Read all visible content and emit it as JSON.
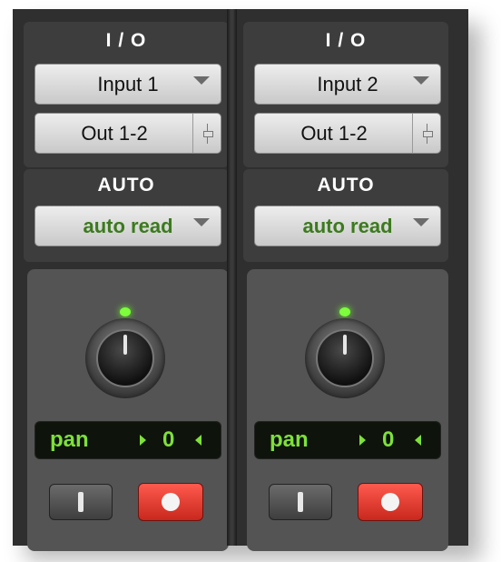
{
  "strips": [
    {
      "io_header": "I / O",
      "input_label": "Input 1",
      "output_label": "Out 1-2",
      "auto_header": "AUTO",
      "auto_mode": "auto read",
      "pan_label": "pan",
      "pan_value": "0"
    },
    {
      "io_header": "I / O",
      "input_label": "Input 2",
      "output_label": "Out 1-2",
      "auto_header": "AUTO",
      "auto_mode": "auto read",
      "pan_label": "pan",
      "pan_value": "0"
    }
  ],
  "colors": {
    "auto_mode_text": "#3c7a1e",
    "pan_text": "#7ee03a",
    "knob_led": "#7dff3c",
    "record_button": "#e0392d"
  },
  "icons": {
    "dropdown": "chevron-down-icon",
    "output_fader": "fader-icon",
    "input_monitor": "input-monitor-icon",
    "record": "record-icon"
  }
}
